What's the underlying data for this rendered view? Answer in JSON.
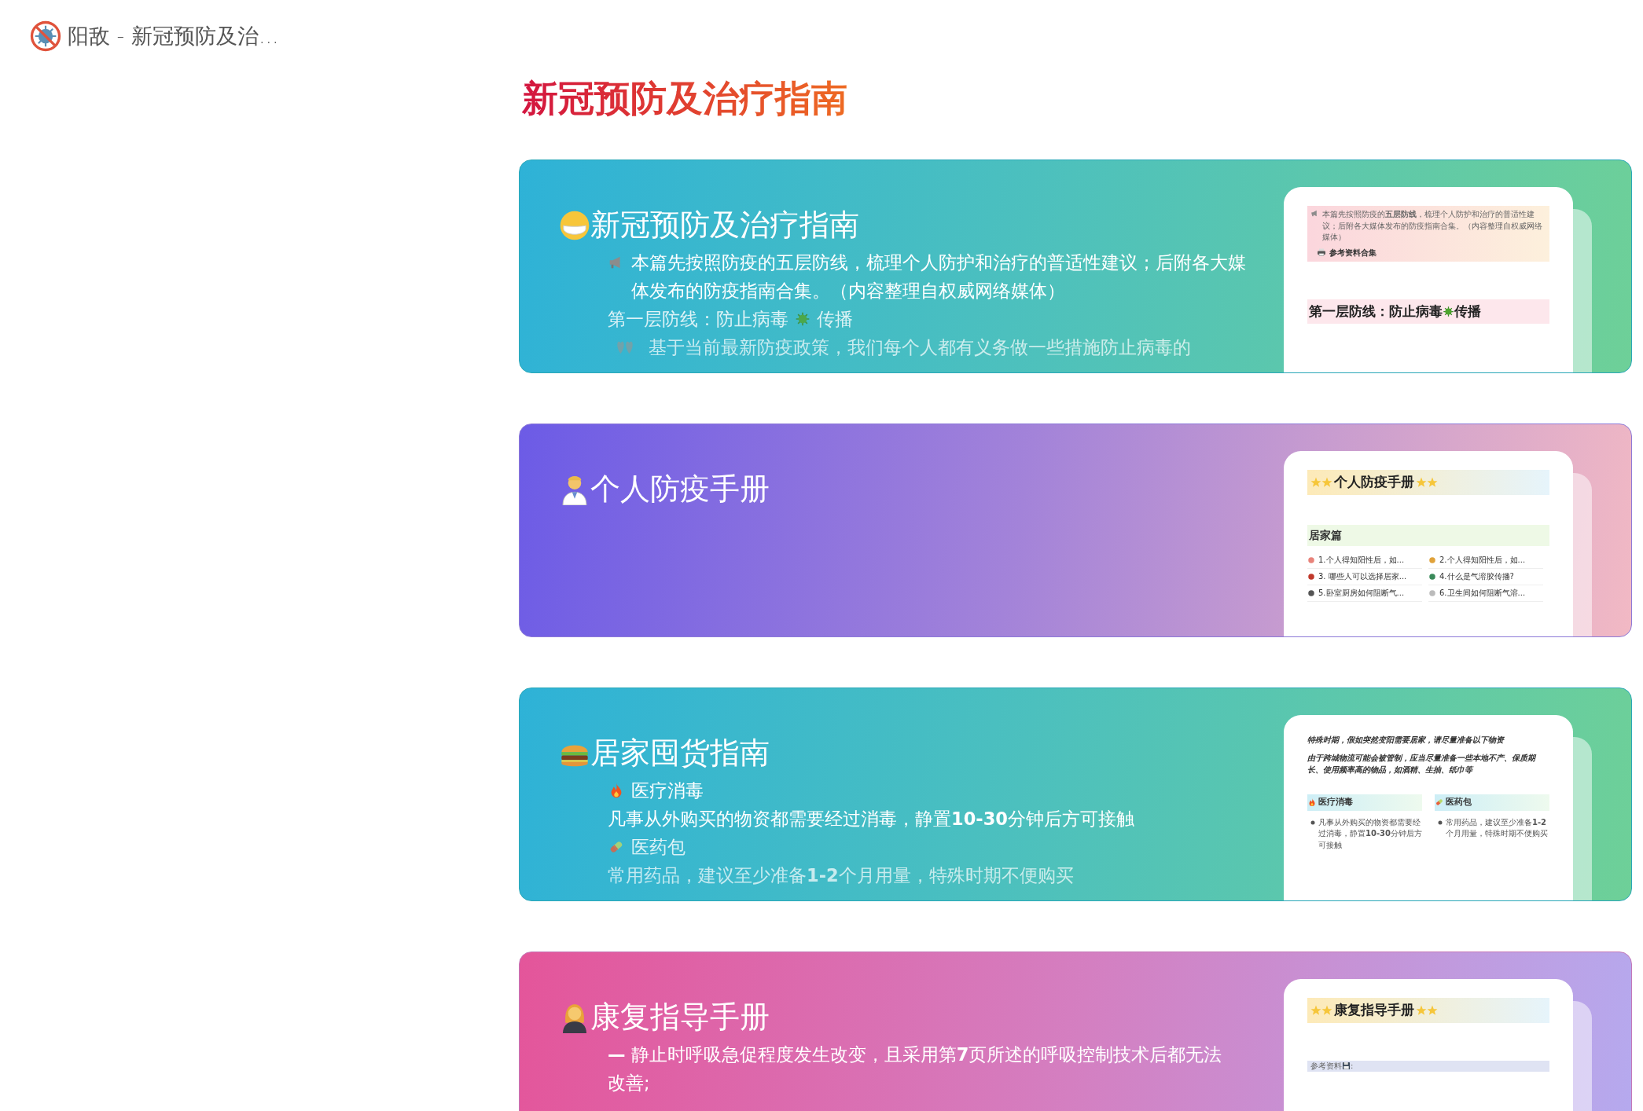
{
  "header": {
    "title": "阳敌 - 新冠预防及治..."
  },
  "page_title": "新冠预防及治疗指南",
  "cards": [
    {
      "kind": "teal",
      "title": "新冠预防及治疗指南",
      "lines": [
        {
          "text": "本篇先按照防疫的五层防线，梳理个人防护和治疗的普适性建议；后附各大媒体发布的防疫指南合集。（内容整理自权威网络媒体）"
        },
        {
          "text": "第一层防线：防止病毒",
          "after": "传播"
        },
        {
          "text": "基于当前最新防疫政策，我们每个人都有义务做一些措施防止病毒的"
        }
      ],
      "preview": {
        "kind": "intro",
        "note": "本篇先按照防疫的**五层防线**，梳理个人防护和治疗的普适性建议；后附各大媒体发布的防疫指南合集。（内容整理自权威网络媒体）",
        "label": "参考资料合集",
        "heading": "第一层防线：防止病毒",
        "heading_after": "传播"
      }
    },
    {
      "kind": "purple",
      "title": "个人防疫手册",
      "preview": {
        "kind": "toc",
        "heading": "个人防疫手册",
        "section": "居家篇",
        "items": [
          "1.个人得知阳性后，如...",
          "2.个人得知阳性后，如...",
          "3. 哪些人可以选择居家...",
          "4.什么是气溶胶传播?",
          "5.卧室厨房如何阻断气...",
          "6.卫生间如何阻断气溶..."
        ]
      }
    },
    {
      "kind": "teal",
      "title": "居家囤货指南",
      "lines": [
        {
          "text": "医疗消毒"
        },
        {
          "text": "凡事从外购买的物资都需要经过消毒，静置**10-30**分钟后方可接触"
        },
        {
          "text": "医药包"
        },
        {
          "text": "常用药品，建议至少准备**1-2**个月用量，特殊时期不便购买"
        }
      ],
      "preview": {
        "kind": "columns",
        "notes": [
          "特殊时期，假如突然变阳需要居家，请尽量准备以下物资",
          "由于跨城物流可能会被管制，应当尽量准备一些本地不产、保质期长、使用频率高的物品，如酒精、生抽、纸巾等"
        ],
        "columns": [
          {
            "heading": "医疗消毒",
            "bullet": "凡事从外购买的物资都需要经过消毒，静置**10-30**分钟后方可接触"
          },
          {
            "heading": "医药包",
            "bullet": "常用药品，建议至少准备**1-2**个月用量，特殊时期不便购买"
          }
        ]
      }
    },
    {
      "kind": "pink",
      "title": "康复指导手册",
      "lines": [
        {
          "text": "**—** 静止时呼吸急促程度发生改变，且采用第**7**页所述的呼吸控制技术后都无法改善;"
        }
      ],
      "preview": {
        "kind": "refs",
        "heading": "康复指导手册",
        "label": "参考资料",
        "label_after": ":"
      }
    }
  ]
}
